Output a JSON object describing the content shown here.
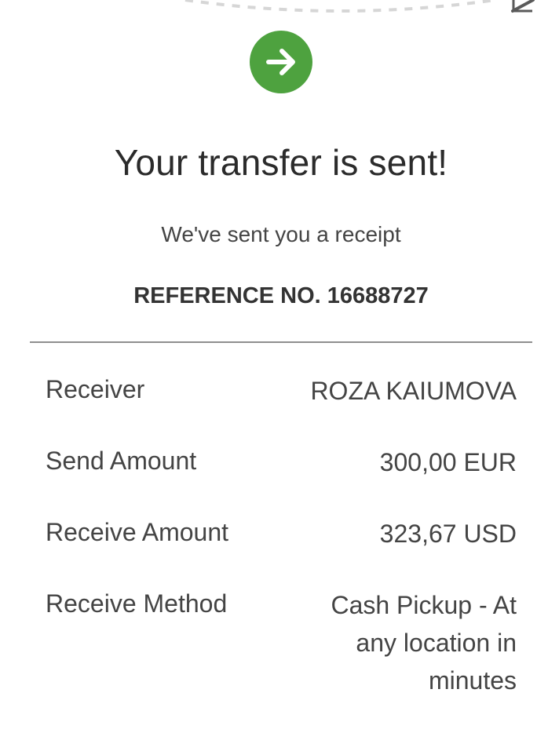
{
  "title": "Your transfer is sent!",
  "subtitle": "We've sent you a receipt",
  "reference_label": "REFERENCE NO. 16688727",
  "status_icon": "arrow-right-icon",
  "colors": {
    "success": "#4ea23f",
    "text": "#444444",
    "divider": "#8e8e8e"
  },
  "details": [
    {
      "label": "Receiver",
      "value": "ROZA KAIUMOVA"
    },
    {
      "label": "Send Amount",
      "value": "300,00 EUR"
    },
    {
      "label": "Receive Amount",
      "value": "323,67 USD"
    },
    {
      "label": "Receive Method",
      "value": "Cash Pickup - At any location in minutes"
    }
  ]
}
